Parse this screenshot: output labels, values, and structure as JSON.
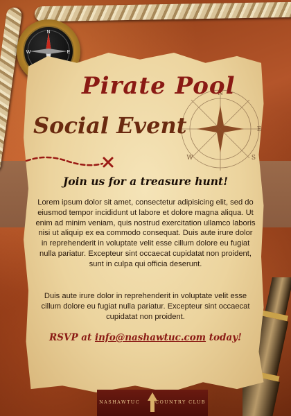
{
  "invitation": {
    "title_line1": "Pirate Pool",
    "title_line2": "Social Event",
    "headline": "Join us for a treasure hunt!",
    "paragraph1": "Lorem ipsum dolor sit amet, consectetur adipisicing elit, sed do eiusmod tempor incididunt ut labore et dolore magna aliqua. Ut enim ad minim veniam, quis nostrud exercitation ullamco laboris nisi ut aliquip ex ea commodo consequat. Duis aute irure dolor in reprehenderit in voluptate velit esse cillum dolore eu fugiat nulla pariatur. Excepteur sint occaecat cupidatat non proident, sunt in culpa qui officia deserunt.",
    "paragraph2": "Duis aute irure dolor in reprehenderit in voluptate velit esse cillum dolore eu fugiat nulla pariatur. Excepteur sint occaecat cupidatat non proident.",
    "rsvp_prefix": "RSVP at ",
    "rsvp_email": "info@nashawtuc.com",
    "rsvp_suffix": " today!"
  },
  "compass_rose": {
    "n": "N",
    "e": "E",
    "s": "S",
    "w": "W"
  },
  "compass_face": {
    "n": "N",
    "e": "E",
    "s": "S",
    "w": "W"
  },
  "footer": {
    "left": "Nashawtuc",
    "right": "Country Club"
  },
  "colors": {
    "title": "#8a1a14",
    "subtitle": "#6a2a10",
    "parchment": "#ecd49e",
    "footer": "#5a140c"
  }
}
